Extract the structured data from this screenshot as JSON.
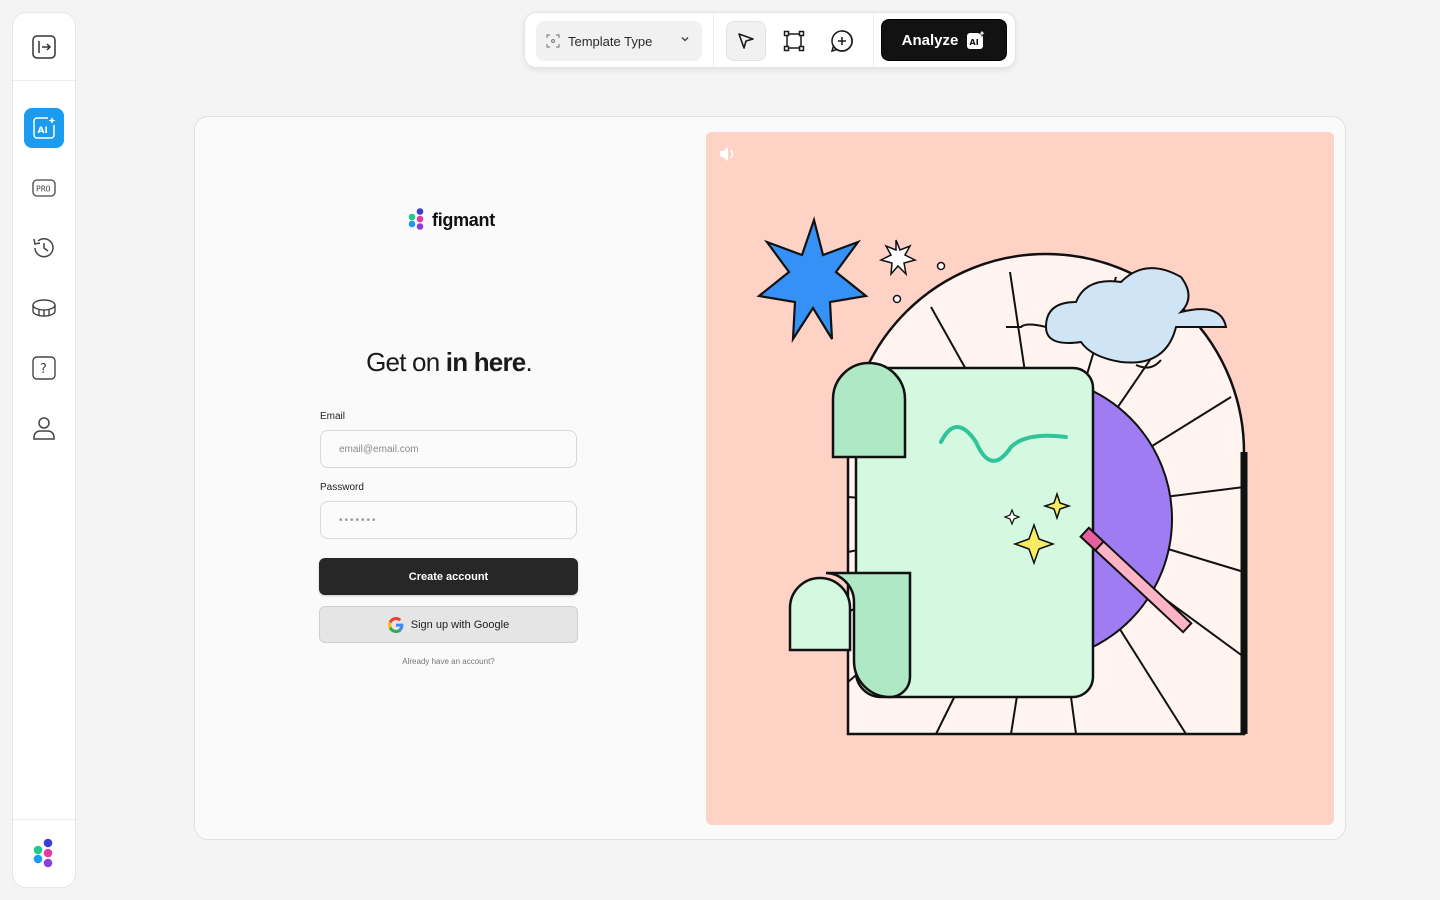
{
  "sidebar": {
    "items": [
      {
        "name": "exit-panel",
        "icon": "sidebar-toggle-icon"
      },
      {
        "name": "ai",
        "icon": "ai-icon",
        "active": true
      },
      {
        "name": "pro",
        "icon": "pro-badge-icon",
        "label": "PRO"
      },
      {
        "name": "history",
        "icon": "history-icon"
      },
      {
        "name": "credits",
        "icon": "coins-icon"
      },
      {
        "name": "help",
        "icon": "help-icon",
        "label": "?"
      },
      {
        "name": "profile",
        "icon": "user-icon"
      }
    ],
    "accent": "#1a9bf0"
  },
  "toolbar": {
    "template_label": "Template Type",
    "analyze_label": "Analyze",
    "analyze_icon_label": "AI"
  },
  "form": {
    "brand": "figmant",
    "headline_light": "Get on ",
    "headline_bold": "in here",
    "headline_period": ".",
    "email_label": "Email",
    "email_placeholder": "email@email.com",
    "password_label": "Password",
    "password_value": "•••••••",
    "create_label": "Create account",
    "google_label": "Sign up with Google",
    "login_link": "Already have an account?"
  },
  "illustration": {
    "background": "#ffd2c6",
    "icons": [
      "sound-icon",
      "star-burst",
      "cloud",
      "scroll",
      "magic-wand",
      "sparkles"
    ]
  }
}
